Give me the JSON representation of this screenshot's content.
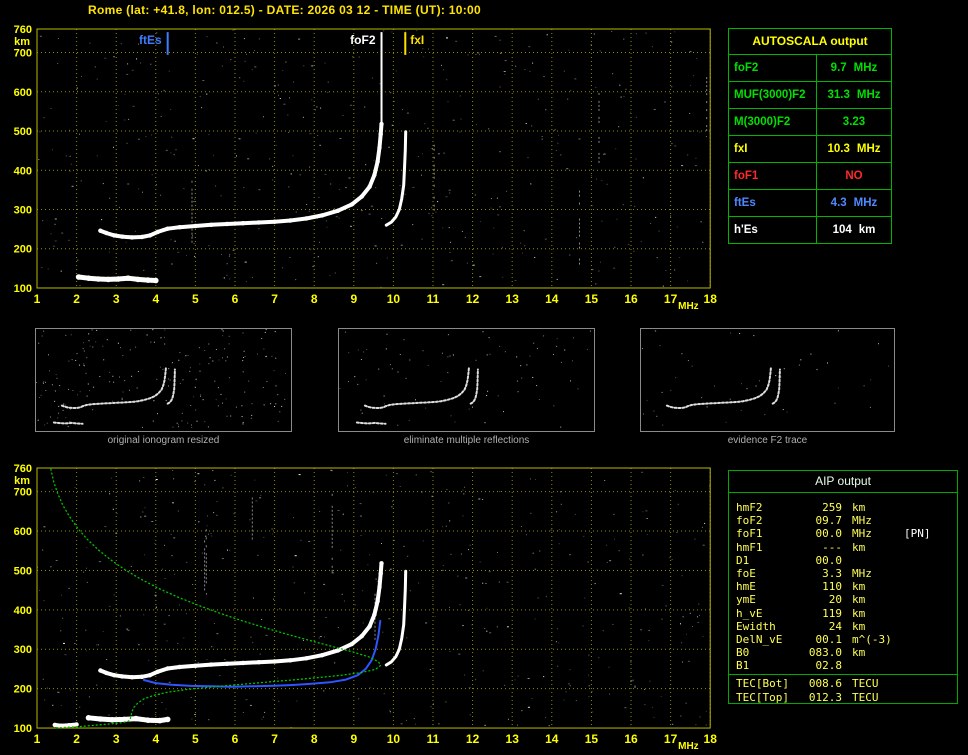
{
  "title": "Rome (lat: +41.8, lon: 012.5) - DATE: 2026 03 12 - TIME (UT): 10:00",
  "autoscala_table": {
    "header": "AUTOSCALA output",
    "rows": [
      {
        "key": "fof2",
        "label": "foF2",
        "value": "9.7",
        "unit": "MHz",
        "color": "#00e000"
      },
      {
        "key": "muf-3000-f2",
        "label": "MUF(3000)F2",
        "value": "31.3",
        "unit": "MHz",
        "color": "#00e000"
      },
      {
        "key": "m-3000-f2",
        "label": "M(3000)F2",
        "value": "3.23",
        "unit": "",
        "color": "#00e000"
      },
      {
        "key": "fxi",
        "label": "fxI",
        "value": "10.3",
        "unit": "MHz",
        "color": "#ffff00"
      },
      {
        "key": "fof1",
        "label": "foF1",
        "value": "NO",
        "unit": "",
        "color": "#ff2a2a"
      },
      {
        "key": "ftes",
        "label": "ftEs",
        "value": "4.3",
        "unit": "MHz",
        "color": "#4d8aff"
      },
      {
        "key": "hpes",
        "label": "h'Es",
        "value": "104",
        "unit": "km",
        "color": "#ffffff"
      }
    ]
  },
  "aip_table": {
    "header": "AIP output",
    "rows": [
      {
        "label": "hmF2",
        "value": "259",
        "unit": "km",
        "note": ""
      },
      {
        "label": "foF2",
        "value": "09.7",
        "unit": "MHz",
        "note": ""
      },
      {
        "label": "foF1",
        "value": "00.0",
        "unit": "MHz",
        "note": "[PN]"
      },
      {
        "label": "hmF1",
        "value": "---",
        "unit": "km",
        "note": ""
      },
      {
        "label": "D1",
        "value": "00.0",
        "unit": "",
        "note": ""
      },
      {
        "label": "foE",
        "value": "3.3",
        "unit": "MHz",
        "note": ""
      },
      {
        "label": "hmE",
        "value": "110",
        "unit": "km",
        "note": ""
      },
      {
        "label": "ymE",
        "value": "20",
        "unit": "km",
        "note": ""
      },
      {
        "label": "h_vE",
        "value": "119",
        "unit": "km",
        "note": ""
      },
      {
        "label": "Ewidth",
        "value": "24",
        "unit": "km",
        "note": ""
      },
      {
        "label": "DelN_vE",
        "value": "00.1",
        "unit": "m^(-3)",
        "note": ""
      },
      {
        "label": "B0",
        "value": "083.0",
        "unit": "km",
        "note": ""
      },
      {
        "label": "B1",
        "value": "02.8",
        "unit": "",
        "note": ""
      }
    ],
    "tec_rows": [
      {
        "label": "TEC[Bot]",
        "value": "008.6",
        "unit": "TECU",
        "note": ""
      },
      {
        "label": "TEC[Top]",
        "value": "012.3",
        "unit": "TECU",
        "note": ""
      }
    ]
  },
  "thumbnails": [
    {
      "caption": "original ionogram resized"
    },
    {
      "caption": "eliminate multiple reflections"
    },
    {
      "caption": "evidence F2 trace"
    }
  ],
  "chart_data": [
    {
      "id": "top_ionogram",
      "type": "scatter",
      "title": "scaled ionogram",
      "xlabel": "MHz",
      "ylabel": "km",
      "xlim": [
        1,
        18
      ],
      "ylim": [
        100,
        760
      ],
      "xticks": [
        1,
        2,
        3,
        4,
        5,
        6,
        7,
        8,
        9,
        10,
        11,
        12,
        13,
        14,
        15,
        16,
        17,
        18
      ],
      "yticks": [
        760,
        700,
        600,
        500,
        400,
        300,
        200,
        100
      ],
      "grid": true,
      "annotations": [
        {
          "label": "ftEs",
          "x_mhz": 4.3,
          "color": "#3f7cff",
          "side": "left",
          "line_km": [
            752,
            694
          ]
        },
        {
          "label": "foF2",
          "x_mhz": 9.7,
          "color": "#ffffff",
          "side": "left",
          "line_km": [
            752,
            520
          ]
        },
        {
          "label": "fxI",
          "x_mhz": 10.3,
          "color": "#ffdf00",
          "side": "right",
          "line_km": [
            752,
            694
          ]
        }
      ],
      "series": [
        {
          "name": "es-trace",
          "color": "#ffffff",
          "width": 5,
          "points": [
            [
              2.05,
              128
            ],
            [
              2.3,
              125
            ],
            [
              2.55,
              123
            ],
            [
              2.8,
              122
            ],
            [
              3.05,
              123
            ],
            [
              3.3,
              125
            ],
            [
              3.55,
              122
            ],
            [
              3.8,
              120
            ],
            [
              4.0,
              119
            ]
          ]
        },
        {
          "name": "f-trace-o",
          "color": "#ffffff",
          "width": 4,
          "points": [
            [
              2.6,
              246
            ],
            [
              2.75,
              240
            ],
            [
              2.95,
              234
            ],
            [
              3.15,
              231
            ],
            [
              3.4,
              229
            ],
            [
              3.65,
              230
            ],
            [
              3.85,
              234
            ],
            [
              4.05,
              243
            ],
            [
              4.3,
              251
            ],
            [
              4.6,
              255
            ],
            [
              5.0,
              258
            ],
            [
              5.4,
              261
            ],
            [
              5.8,
              263
            ],
            [
              6.2,
              265
            ],
            [
              6.6,
              267
            ],
            [
              7.0,
              269
            ],
            [
              7.4,
              272
            ],
            [
              7.8,
              277
            ],
            [
              8.2,
              285
            ],
            [
              8.6,
              297
            ],
            [
              8.95,
              313
            ],
            [
              9.2,
              333
            ],
            [
              9.4,
              358
            ],
            [
              9.52,
              388
            ],
            [
              9.6,
              422
            ],
            [
              9.65,
              458
            ],
            [
              9.68,
              492
            ],
            [
              9.7,
              518
            ]
          ]
        },
        {
          "name": "f-trace-x",
          "color": "#ffffff",
          "width": 3,
          "points": [
            [
              9.82,
              260
            ],
            [
              9.95,
              268
            ],
            [
              10.06,
              281
            ],
            [
              10.15,
              300
            ],
            [
              10.21,
              327
            ],
            [
              10.26,
              362
            ],
            [
              10.28,
              405
            ],
            [
              10.3,
              452
            ],
            [
              10.31,
              498
            ]
          ]
        }
      ]
    },
    {
      "id": "bottom_ionogram",
      "type": "scatter",
      "title": "restored trace and electron density profile",
      "xlabel": "MHz",
      "ylabel": "km",
      "xlim": [
        1,
        18
      ],
      "ylim": [
        100,
        760
      ],
      "xticks": [
        1,
        2,
        3,
        4,
        5,
        6,
        7,
        8,
        9,
        10,
        11,
        12,
        13,
        14,
        15,
        16,
        17,
        18
      ],
      "yticks": [
        760,
        700,
        600,
        500,
        400,
        300,
        200,
        100
      ],
      "grid": true,
      "annotations": [],
      "series": [
        {
          "name": "es-trace",
          "color": "#ffffff",
          "width": 5,
          "points": [
            [
              2.3,
              126
            ],
            [
              2.6,
              123
            ],
            [
              2.9,
              121
            ],
            [
              3.2,
              122
            ],
            [
              3.5,
              124
            ],
            [
              3.8,
              120
            ],
            [
              4.1,
              119
            ],
            [
              4.3,
              122
            ]
          ]
        },
        {
          "name": "es-trace-2",
          "color": "#ffffff",
          "width": 4,
          "points": [
            [
              1.45,
              108
            ],
            [
              1.6,
              106
            ],
            [
              1.8,
              107
            ],
            [
              2.0,
              109
            ]
          ]
        },
        {
          "name": "f-trace-o",
          "color": "#ffffff",
          "width": 4,
          "points": [
            [
              2.6,
              246
            ],
            [
              2.75,
              240
            ],
            [
              2.95,
              234
            ],
            [
              3.15,
              231
            ],
            [
              3.4,
              229
            ],
            [
              3.65,
              230
            ],
            [
              3.85,
              234
            ],
            [
              4.05,
              243
            ],
            [
              4.3,
              251
            ],
            [
              4.6,
              255
            ],
            [
              5.0,
              258
            ],
            [
              5.4,
              261
            ],
            [
              5.8,
              263
            ],
            [
              6.2,
              265
            ],
            [
              6.6,
              267
            ],
            [
              7.0,
              269
            ],
            [
              7.4,
              272
            ],
            [
              7.8,
              277
            ],
            [
              8.2,
              285
            ],
            [
              8.6,
              297
            ],
            [
              8.95,
              313
            ],
            [
              9.2,
              333
            ],
            [
              9.4,
              358
            ],
            [
              9.52,
              388
            ],
            [
              9.6,
              422
            ],
            [
              9.65,
              458
            ],
            [
              9.68,
              492
            ],
            [
              9.7,
              518
            ]
          ]
        },
        {
          "name": "f-trace-x",
          "color": "#ffffff",
          "width": 3,
          "points": [
            [
              9.82,
              260
            ],
            [
              9.95,
              268
            ],
            [
              10.06,
              281
            ],
            [
              10.15,
              300
            ],
            [
              10.21,
              327
            ],
            [
              10.26,
              362
            ],
            [
              10.28,
              405
            ],
            [
              10.3,
              452
            ],
            [
              10.31,
              498
            ]
          ]
        },
        {
          "name": "restored-trace",
          "color": "#2e55ff",
          "width": 2,
          "points": [
            [
              3.7,
              222
            ],
            [
              4.0,
              214
            ],
            [
              4.4,
              210
            ],
            [
              4.9,
              207
            ],
            [
              5.4,
              206
            ],
            [
              5.9,
              205
            ],
            [
              6.4,
              206
            ],
            [
              6.9,
              207
            ],
            [
              7.4,
              209
            ],
            [
              7.9,
              212
            ],
            [
              8.4,
              216
            ],
            [
              8.8,
              223
            ],
            [
              9.1,
              234
            ],
            [
              9.3,
              250
            ],
            [
              9.45,
              272
            ],
            [
              9.55,
              300
            ],
            [
              9.62,
              335
            ],
            [
              9.67,
              372
            ]
          ]
        },
        {
          "name": "ne-profile",
          "color": "#00c400",
          "width": 1.3,
          "dash": "1,3",
          "points": [
            [
              1.35,
              757
            ],
            [
              1.42,
              726
            ],
            [
              1.52,
              696
            ],
            [
              1.65,
              666
            ],
            [
              1.82,
              637
            ],
            [
              2.02,
              608
            ],
            [
              2.26,
              580
            ],
            [
              2.54,
              553
            ],
            [
              2.86,
              527
            ],
            [
              3.22,
              502
            ],
            [
              3.62,
              478
            ],
            [
              4.06,
              455
            ],
            [
              4.54,
              433
            ],
            [
              5.06,
              412
            ],
            [
              5.6,
              392
            ],
            [
              6.16,
              373
            ],
            [
              6.74,
              355
            ],
            [
              7.32,
              338
            ],
            [
              7.9,
              322
            ],
            [
              8.46,
              307
            ],
            [
              8.98,
              293
            ],
            [
              9.4,
              280
            ],
            [
              9.62,
              268
            ],
            [
              9.68,
              259
            ],
            [
              9.55,
              249
            ],
            [
              9.2,
              241
            ],
            [
              8.7,
              234
            ],
            [
              8.1,
              228
            ],
            [
              7.45,
              222
            ],
            [
              6.75,
              216
            ],
            [
              6.05,
              210
            ],
            [
              5.4,
              204
            ],
            [
              4.8,
              198
            ],
            [
              4.3,
              191
            ],
            [
              3.95,
              183
            ],
            [
              3.7,
              174
            ],
            [
              3.55,
              164
            ],
            [
              3.45,
              153
            ],
            [
              3.4,
              142
            ],
            [
              3.37,
              131
            ],
            [
              3.35,
              121
            ],
            [
              3.3,
              117
            ],
            [
              3.1,
              113
            ],
            [
              2.8,
              110
            ],
            [
              2.45,
              107
            ],
            [
              2.1,
              104
            ],
            [
              1.75,
              102
            ],
            [
              1.45,
              100
            ]
          ]
        }
      ]
    }
  ]
}
